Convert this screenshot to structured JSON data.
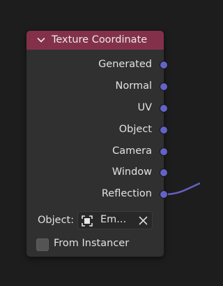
{
  "node": {
    "title": "Texture Coordinate",
    "header_color": "#83314a",
    "socket_color": "#6363c7",
    "outputs": [
      {
        "label": "Generated"
      },
      {
        "label": "Normal"
      },
      {
        "label": "UV"
      },
      {
        "label": "Object"
      },
      {
        "label": "Camera"
      },
      {
        "label": "Window"
      },
      {
        "label": "Reflection"
      }
    ],
    "object_property": {
      "label": "Object:",
      "value": "Em...",
      "icon": "empty-object-icon",
      "clear_icon": "close-icon"
    },
    "from_instancer": {
      "label": "From Instancer",
      "checked": false
    }
  }
}
